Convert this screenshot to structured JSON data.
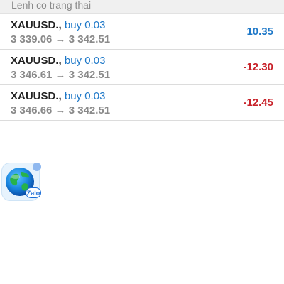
{
  "section": {
    "title": "Lenh co trang thai"
  },
  "positions": [
    {
      "symbol": "XAUUSD.,",
      "side": "buy 0.03",
      "prices": "3 339.06 → 3 342.51",
      "profit": "10.35"
    },
    {
      "symbol": "XAUUSD.,",
      "side": "buy 0.03",
      "prices": "3 346.61 → 3 342.51",
      "profit": "-12.30"
    },
    {
      "symbol": "XAUUSD.,",
      "side": "buy 0.03",
      "prices": "3 346.66 → 3 342.51",
      "profit": "-12.45"
    }
  ],
  "floating_icon": {
    "app": "Zalo",
    "label": "Zalo",
    "icon": "zalo-globe-icon"
  },
  "colors": {
    "profit_positive": "#1e78c8",
    "profit_negative": "#c8222a",
    "side_text": "#1e78c8"
  }
}
